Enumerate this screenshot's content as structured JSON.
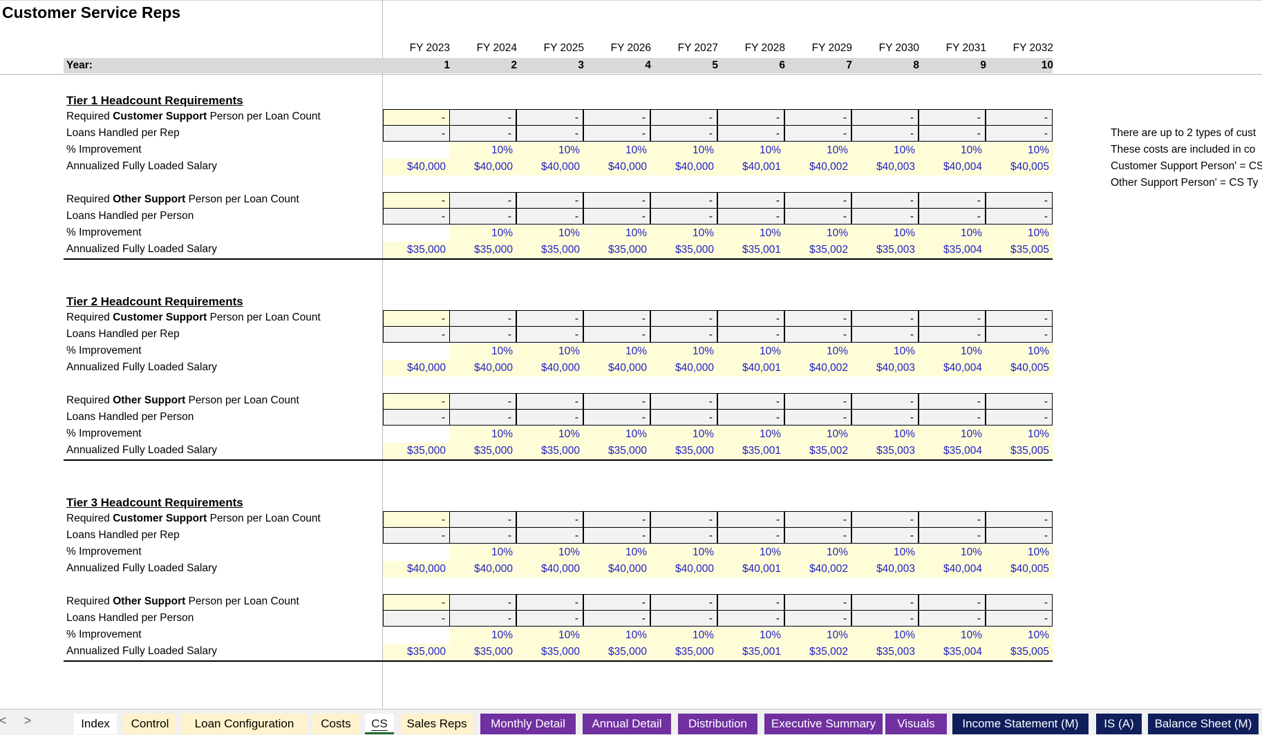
{
  "title": "Customer Service Reps",
  "fiscal_years": [
    "FY 2023",
    "FY 2024",
    "FY 2025",
    "FY 2026",
    "FY 2027",
    "FY 2028",
    "FY 2029",
    "FY 2030",
    "FY 2031",
    "FY 2032"
  ],
  "year_label": "Year:",
  "year_numbers": [
    "1",
    "2",
    "3",
    "4",
    "5",
    "6",
    "7",
    "8",
    "9",
    "10"
  ],
  "tiers": [
    {
      "heading": "Tier 1 Headcount Requirements",
      "rows": [
        {
          "label_pre": "Required ",
          "label_bold": "Customer Support",
          "label_post": " Person per Loan Count",
          "kind": "input",
          "values": [
            "-",
            "-",
            "-",
            "-",
            "-",
            "-",
            "-",
            "-",
            "-",
            "-"
          ]
        },
        {
          "label_pre": "Loans Handled per Rep",
          "label_bold": "",
          "label_post": "",
          "kind": "calc",
          "values": [
            "-",
            "-",
            "-",
            "-",
            "-",
            "-",
            "-",
            "-",
            "-",
            "-"
          ]
        },
        {
          "label_pre": "% Improvement",
          "label_bold": "",
          "label_post": "",
          "kind": "pct",
          "values": [
            "",
            "10%",
            "10%",
            "10%",
            "10%",
            "10%",
            "10%",
            "10%",
            "10%",
            "10%"
          ]
        },
        {
          "label_pre": "Annualized Fully Loaded Salary",
          "label_bold": "",
          "label_post": "",
          "kind": "salary",
          "values": [
            "$40,000",
            "$40,000",
            "$40,000",
            "$40,000",
            "$40,000",
            "$40,001",
            "$40,002",
            "$40,003",
            "$40,004",
            "$40,005"
          ]
        },
        {
          "label_pre": "Required ",
          "label_bold": "Other Support",
          "label_post": " Person per Loan Count",
          "kind": "input",
          "values": [
            "-",
            "-",
            "-",
            "-",
            "-",
            "-",
            "-",
            "-",
            "-",
            "-"
          ]
        },
        {
          "label_pre": "Loans Handled per Person",
          "label_bold": "",
          "label_post": "",
          "kind": "calc",
          "values": [
            "-",
            "-",
            "-",
            "-",
            "-",
            "-",
            "-",
            "-",
            "-",
            "-"
          ]
        },
        {
          "label_pre": "% Improvement",
          "label_bold": "",
          "label_post": "",
          "kind": "pct",
          "values": [
            "",
            "10%",
            "10%",
            "10%",
            "10%",
            "10%",
            "10%",
            "10%",
            "10%",
            "10%"
          ]
        },
        {
          "label_pre": "Annualized Fully Loaded Salary",
          "label_bold": "",
          "label_post": "",
          "kind": "salary",
          "values": [
            "$35,000",
            "$35,000",
            "$35,000",
            "$35,000",
            "$35,000",
            "$35,001",
            "$35,002",
            "$35,003",
            "$35,004",
            "$35,005"
          ]
        }
      ]
    },
    {
      "heading": "Tier 2 Headcount Requirements",
      "rows": [
        {
          "label_pre": "Required ",
          "label_bold": "Customer Support",
          "label_post": " Person per Loan Count",
          "kind": "input",
          "values": [
            "-",
            "-",
            "-",
            "-",
            "-",
            "-",
            "-",
            "-",
            "-",
            "-"
          ]
        },
        {
          "label_pre": "Loans Handled per Rep",
          "label_bold": "",
          "label_post": "",
          "kind": "calc",
          "values": [
            "-",
            "-",
            "-",
            "-",
            "-",
            "-",
            "-",
            "-",
            "-",
            "-"
          ]
        },
        {
          "label_pre": "% Improvement",
          "label_bold": "",
          "label_post": "",
          "kind": "pct",
          "values": [
            "",
            "10%",
            "10%",
            "10%",
            "10%",
            "10%",
            "10%",
            "10%",
            "10%",
            "10%"
          ]
        },
        {
          "label_pre": "Annualized Fully Loaded Salary",
          "label_bold": "",
          "label_post": "",
          "kind": "salary",
          "values": [
            "$40,000",
            "$40,000",
            "$40,000",
            "$40,000",
            "$40,000",
            "$40,001",
            "$40,002",
            "$40,003",
            "$40,004",
            "$40,005"
          ]
        },
        {
          "label_pre": "Required ",
          "label_bold": "Other Support",
          "label_post": " Person per Loan Count",
          "kind": "input",
          "values": [
            "-",
            "-",
            "-",
            "-",
            "-",
            "-",
            "-",
            "-",
            "-",
            "-"
          ]
        },
        {
          "label_pre": "Loans Handled per Person",
          "label_bold": "",
          "label_post": "",
          "kind": "calc",
          "values": [
            "-",
            "-",
            "-",
            "-",
            "-",
            "-",
            "-",
            "-",
            "-",
            "-"
          ]
        },
        {
          "label_pre": "% Improvement",
          "label_bold": "",
          "label_post": "",
          "kind": "pct",
          "values": [
            "",
            "10%",
            "10%",
            "10%",
            "10%",
            "10%",
            "10%",
            "10%",
            "10%",
            "10%"
          ]
        },
        {
          "label_pre": "Annualized Fully Loaded Salary",
          "label_bold": "",
          "label_post": "",
          "kind": "salary",
          "values": [
            "$35,000",
            "$35,000",
            "$35,000",
            "$35,000",
            "$35,000",
            "$35,001",
            "$35,002",
            "$35,003",
            "$35,004",
            "$35,005"
          ]
        }
      ]
    },
    {
      "heading": "Tier 3 Headcount Requirements",
      "rows": [
        {
          "label_pre": "Required ",
          "label_bold": "Customer Support",
          "label_post": " Person per Loan Count",
          "kind": "input",
          "values": [
            "-",
            "-",
            "-",
            "-",
            "-",
            "-",
            "-",
            "-",
            "-",
            "-"
          ]
        },
        {
          "label_pre": "Loans Handled per Rep",
          "label_bold": "",
          "label_post": "",
          "kind": "calc",
          "values": [
            "-",
            "-",
            "-",
            "-",
            "-",
            "-",
            "-",
            "-",
            "-",
            "-"
          ]
        },
        {
          "label_pre": "% Improvement",
          "label_bold": "",
          "label_post": "",
          "kind": "pct",
          "values": [
            "",
            "10%",
            "10%",
            "10%",
            "10%",
            "10%",
            "10%",
            "10%",
            "10%",
            "10%"
          ]
        },
        {
          "label_pre": "Annualized Fully Loaded Salary",
          "label_bold": "",
          "label_post": "",
          "kind": "salary",
          "values": [
            "$40,000",
            "$40,000",
            "$40,000",
            "$40,000",
            "$40,000",
            "$40,001",
            "$40,002",
            "$40,003",
            "$40,004",
            "$40,005"
          ]
        },
        {
          "label_pre": "Required ",
          "label_bold": "Other Support",
          "label_post": " Person per Loan Count",
          "kind": "input",
          "values": [
            "-",
            "-",
            "-",
            "-",
            "-",
            "-",
            "-",
            "-",
            "-",
            "-"
          ]
        },
        {
          "label_pre": "Loans Handled per Person",
          "label_bold": "",
          "label_post": "",
          "kind": "calc",
          "values": [
            "-",
            "-",
            "-",
            "-",
            "-",
            "-",
            "-",
            "-",
            "-",
            "-"
          ]
        },
        {
          "label_pre": "% Improvement",
          "label_bold": "",
          "label_post": "",
          "kind": "pct",
          "values": [
            "",
            "10%",
            "10%",
            "10%",
            "10%",
            "10%",
            "10%",
            "10%",
            "10%",
            "10%"
          ]
        },
        {
          "label_pre": "Annualized Fully Loaded Salary",
          "label_bold": "",
          "label_post": "",
          "kind": "salary",
          "values": [
            "$35,000",
            "$35,000",
            "$35,000",
            "$35,000",
            "$35,000",
            "$35,001",
            "$35,002",
            "$35,003",
            "$35,004",
            "$35,005"
          ]
        }
      ]
    }
  ],
  "notes": [
    "There are up to 2 types of cust",
    "These costs are included in co",
    "Customer Support Person' = CS",
    "Other Support Person' = CS Ty"
  ],
  "nav": {
    "prev": "<",
    "next": ">"
  },
  "tabs": [
    {
      "label": "Index",
      "style": "white"
    },
    {
      "label": "Control",
      "style": "yellow"
    },
    {
      "label": "Loan Configuration",
      "style": "yellow"
    },
    {
      "label": "Costs",
      "style": "yellow"
    },
    {
      "label": "CS",
      "style": "active"
    },
    {
      "label": "Sales Reps",
      "style": "yellow"
    },
    {
      "label": "Monthly Detail",
      "style": "purple"
    },
    {
      "label": "Annual Detail",
      "style": "purple"
    },
    {
      "label": "Distribution",
      "style": "purple"
    },
    {
      "label": "Executive Summary",
      "style": "purple"
    },
    {
      "label": "Visuals",
      "style": "purple"
    },
    {
      "label": "Income Statement (M)",
      "style": "navy"
    },
    {
      "label": "IS (A)",
      "style": "navy"
    },
    {
      "label": "Balance Sheet (M)",
      "style": "navy"
    }
  ],
  "colors": {
    "input_fill": "#fffdd7",
    "calc_fill": "#f2f2f2",
    "input_font": "#1f1fc4",
    "purple_tab": "#7030a0",
    "navy_tab": "#0e1f5b",
    "yellow_tab": "#fff2cc"
  }
}
